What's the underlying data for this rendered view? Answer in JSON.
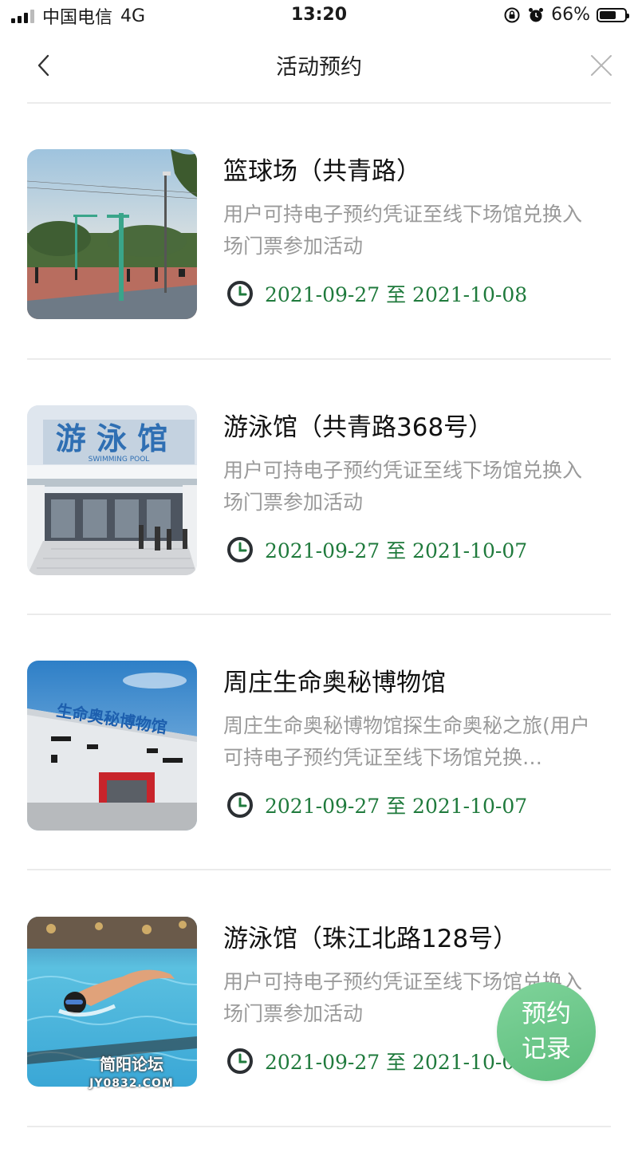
{
  "status_bar": {
    "carrier": "中国电信",
    "network": "4G",
    "time": "13:20",
    "battery": "66%",
    "battery_level": 0.66
  },
  "nav": {
    "title": "活动预约",
    "back_icon": "chevron-left-icon",
    "close_icon": "close-icon"
  },
  "items": [
    {
      "title": "篮球场（共青路）",
      "description": "用户可持电子预约凭证至线下场馆兑换入场门票参加活动",
      "date": "2021-09-27 至 2021-10-08",
      "image": "basketball-court-photo"
    },
    {
      "title": "游泳馆（共青路368号）",
      "description": "用户可持电子预约凭证至线下场馆兑换入场门票参加活动",
      "date": "2021-09-27 至 2021-10-07",
      "image": "swimming-hall-building-photo",
      "image_sign": "游 泳 馆",
      "image_sign_sub": "SWIMMING POOL"
    },
    {
      "title": "周庄生命奥秘博物馆",
      "description": "周庄生命奥秘博物馆探生命奥秘之旅(用户可持电子预约凭证至线下场馆兑换…",
      "date": "2021-09-27 至 2021-10-07",
      "image": "museum-building-photo",
      "image_sign": "生命奥秘博物馆"
    },
    {
      "title": "游泳馆（珠江北路128号）",
      "description": "用户可持电子预约凭证至线下场馆兑换入场门票参加活动",
      "date": "2021-09-27 至 2021-10-07",
      "image": "swimmer-pool-photo"
    }
  ],
  "fab": {
    "line1": "预约",
    "line2": "记录"
  },
  "watermark": {
    "line1": "简阳论坛",
    "line2": "JY0832.COM"
  },
  "colors": {
    "accent": "#1f7a3c",
    "fab": "#6cc78a",
    "divider": "#ebebeb"
  }
}
